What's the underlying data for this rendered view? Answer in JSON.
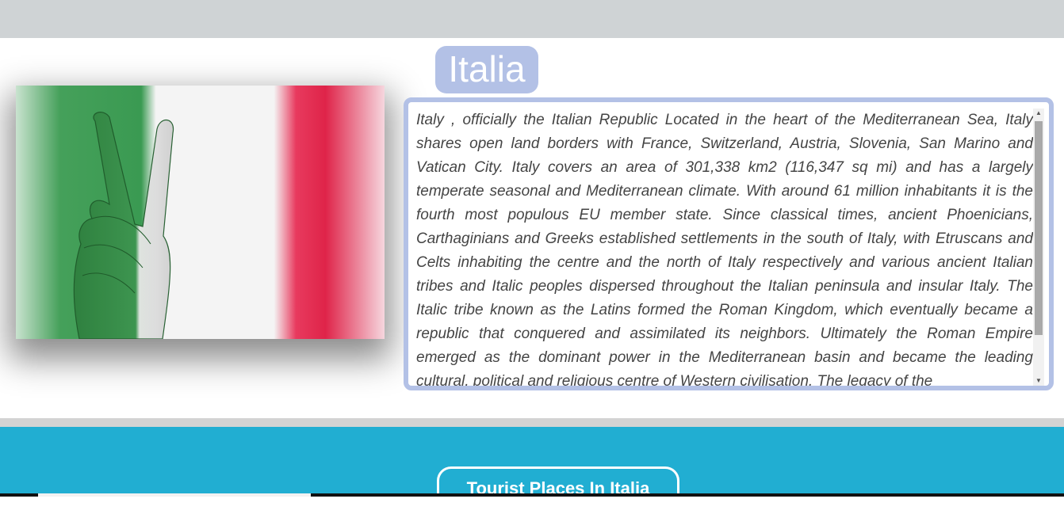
{
  "header": {
    "title": "Italia"
  },
  "flag_image": {
    "alt": "Hand making a peace sign painted in Italian flag colors",
    "colors": {
      "green": "#2f8f46",
      "white": "#f4f4f4",
      "red": "#df2449"
    }
  },
  "description": {
    "text": "Italy , officially the Italian Republic Located in the heart of the Mediterranean Sea, Italy shares open land borders with France, Switzerland, Austria, Slovenia, San Marino and Vatican City. Italy covers an area of 301,338 km2 (116,347 sq mi) and has a largely temperate seasonal and Mediterranean climate. With around 61 million inhabitants it is the fourth most populous EU member state. Since classical times, ancient Phoenicians, Carthaginians and Greeks established settlements in the south of Italy, with Etruscans and Celts inhabiting the centre and the north of Italy respectively and various ancient Italian tribes and Italic peoples dispersed throughout the Italian peninsula and insular Italy. The Italic tribe known as the Latins formed the Roman Kingdom, which eventually became a republic that conquered and assimilated its neighbors. Ultimately the Roman Empire emerged as the dominant power in the Mediterranean basin and became the leading cultural, political and religious centre of Western civilisation. The legacy of the"
  },
  "tourist_section": {
    "button_label": "Tourist Places In Italia"
  },
  "colors": {
    "accent_pill": "#b3c1e6",
    "band": "#21aed2",
    "top_strip": "#cfd3d5"
  }
}
